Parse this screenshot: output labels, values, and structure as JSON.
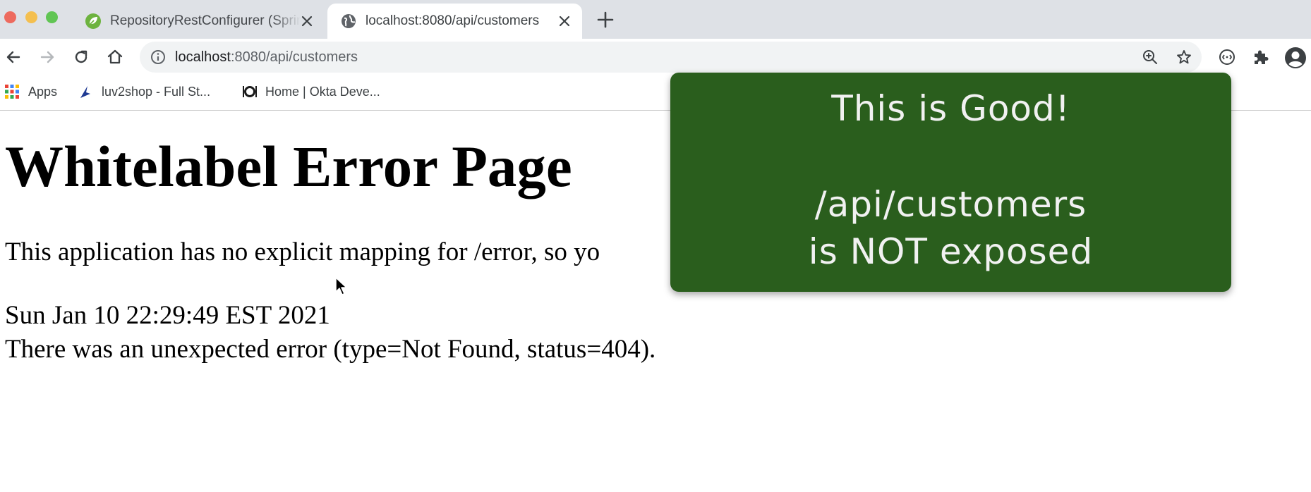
{
  "browser": {
    "tabs": [
      {
        "title": "RepositoryRestConfigurer (Spring",
        "icon": "spring-leaf-icon",
        "active": false
      },
      {
        "title": "localhost:8080/api/customers",
        "icon": "globe-icon",
        "active": true
      }
    ],
    "address_bar": {
      "host": "localhost",
      "path": ":8080/api/customers"
    },
    "bookmarks": [
      {
        "label": "Apps",
        "icon": "apps-grid-icon"
      },
      {
        "label": "luv2shop - Full St...",
        "icon": "luv2shop-icon"
      },
      {
        "label": "Home | Okta Deve...",
        "icon": "okta-icon"
      }
    ]
  },
  "page": {
    "heading": "Whitelabel Error Page",
    "message": "This application has no explicit mapping for /error, so yo",
    "timestamp": "Sun Jan 10 22:29:49 EST 2021",
    "error": "There was an unexpected error (type=Not Found, status=404)."
  },
  "callout": {
    "title": "This is Good!",
    "line1": "/api/customers",
    "line2": "is NOT exposed",
    "background": "#2a5e1d"
  }
}
